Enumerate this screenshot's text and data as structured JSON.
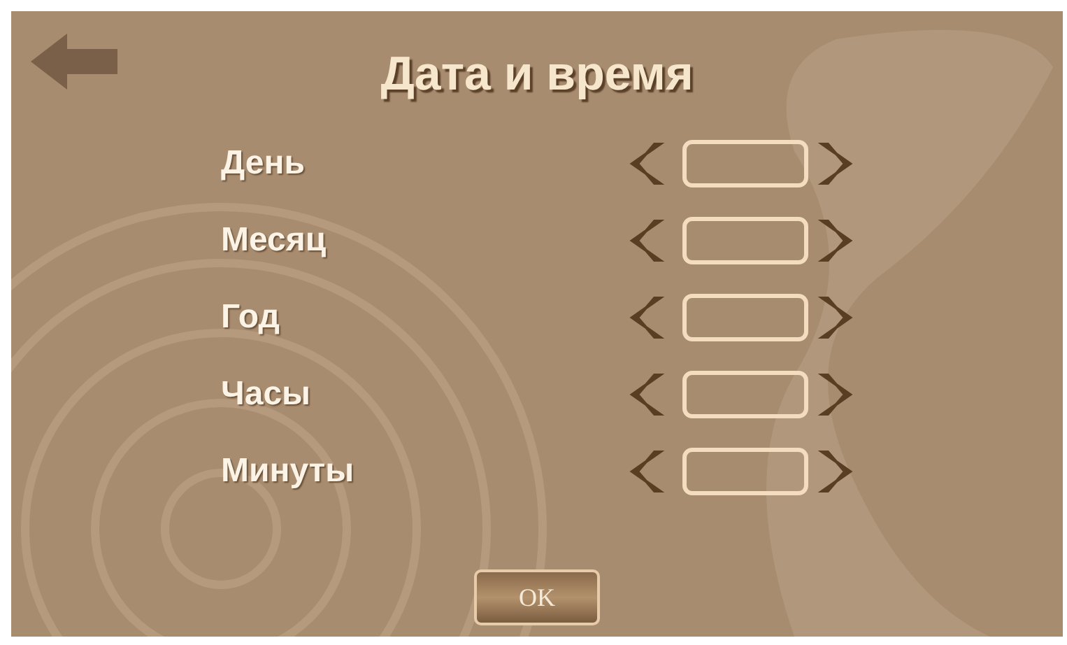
{
  "screen": {
    "title": "Дата и время"
  },
  "fields": [
    {
      "label": "День"
    },
    {
      "label": "Месяц"
    },
    {
      "label": "Год"
    },
    {
      "label": "Часы"
    },
    {
      "label": "Минуты"
    }
  ],
  "buttons": [
    {
      "label": "OK"
    }
  ]
}
